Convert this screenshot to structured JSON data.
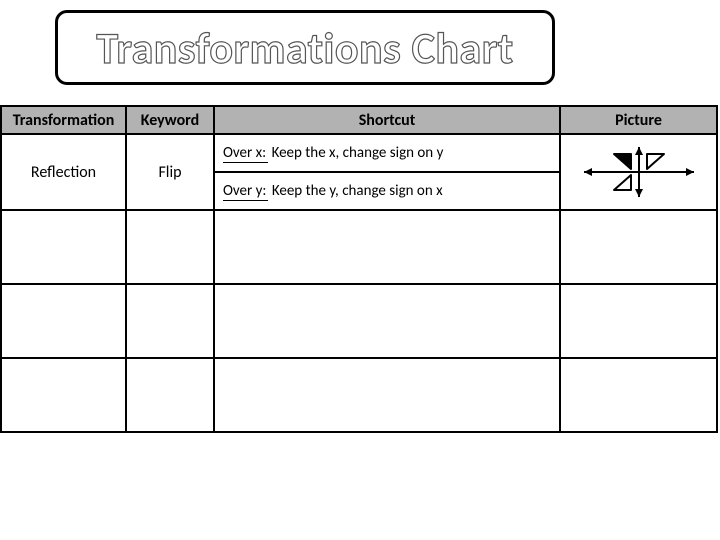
{
  "title": "Transformations Chart",
  "headers": {
    "transformation": "Transformation",
    "keyword": "Keyword",
    "shortcut": "Shortcut",
    "picture": "Picture"
  },
  "rows": [
    {
      "transformation": "Reflection",
      "keyword": "Flip",
      "shortcuts": [
        {
          "label": "Over x:",
          "rule": "Keep the x, change sign on y"
        },
        {
          "label": "Over y:",
          "rule": "Keep the y, change sign on x"
        }
      ],
      "picture_icon": "reflection-quadrants-icon"
    },
    {
      "transformation": "",
      "keyword": "",
      "shortcuts": [],
      "picture_icon": ""
    },
    {
      "transformation": "",
      "keyword": "",
      "shortcuts": [],
      "picture_icon": ""
    },
    {
      "transformation": "",
      "keyword": "",
      "shortcuts": [],
      "picture_icon": ""
    }
  ]
}
